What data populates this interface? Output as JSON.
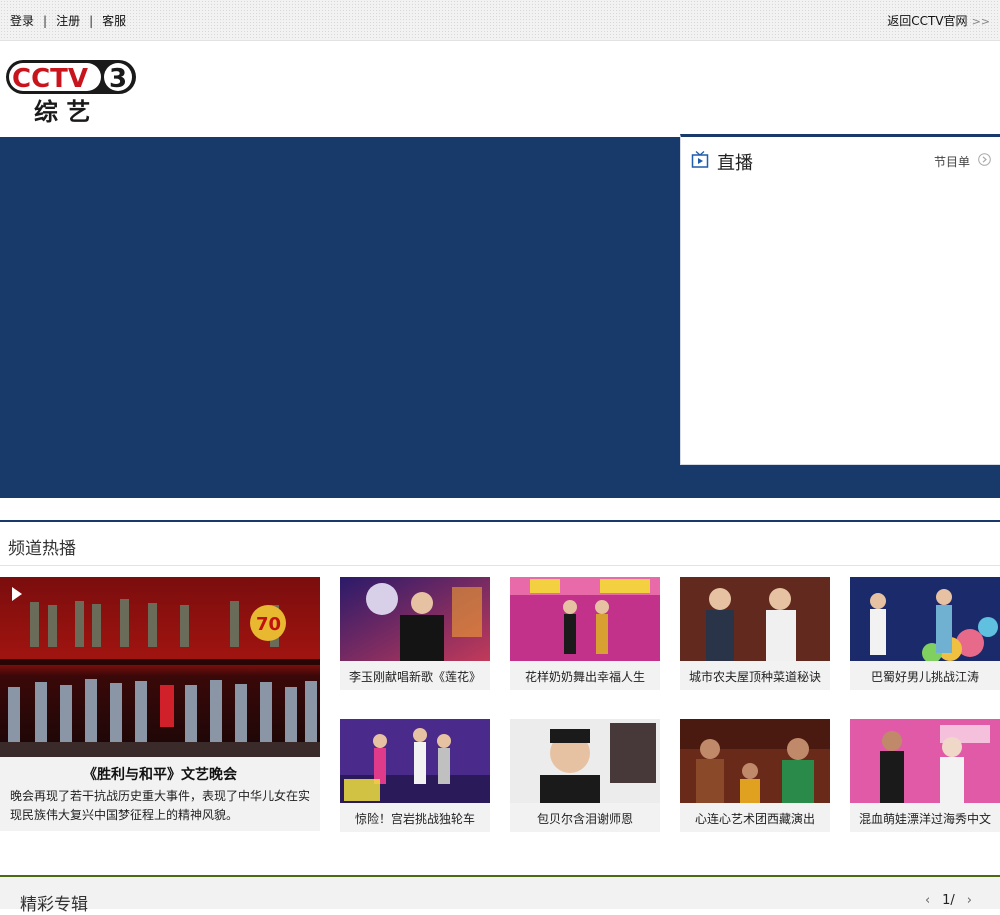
{
  "topbar": {
    "login": "登录",
    "register": "注册",
    "service": "客服",
    "separator": "|",
    "back_link": "返回CCTV官网",
    "back_arrows": ">>"
  },
  "logo": {
    "brand": "CCTV",
    "channel_no": "3",
    "channel_name": "综 艺"
  },
  "live": {
    "title": "直播",
    "schedule": "节目单"
  },
  "hot": {
    "title": "频道热播",
    "featured": {
      "title": "《胜利与和平》文艺晚会",
      "desc": "晚会再现了若干抗战历史重大事件，表现了中华儿女在实现民族伟大复兴中国梦征程上的精神风貌。",
      "badge": "70"
    },
    "items": [
      {
        "caption": "李玉刚献唱新歌《莲花》"
      },
      {
        "caption": "花样奶奶舞出幸福人生"
      },
      {
        "caption": "城市农夫屋顶种菜道秘诀"
      },
      {
        "caption": "巴蜀好男儿挑战江涛"
      },
      {
        "caption": "惊险！宫岩挑战独轮车"
      },
      {
        "caption": "包贝尔含泪谢师恩"
      },
      {
        "caption": "心连心艺术团西藏演出"
      },
      {
        "caption": "混血萌娃漂洋过海秀中文"
      }
    ]
  },
  "album": {
    "title": "精彩专辑",
    "page": "1/",
    "prev": "‹",
    "next": "›"
  },
  "colors": {
    "brand_blue": "#173a6b",
    "album_green": "#4e6a10"
  }
}
